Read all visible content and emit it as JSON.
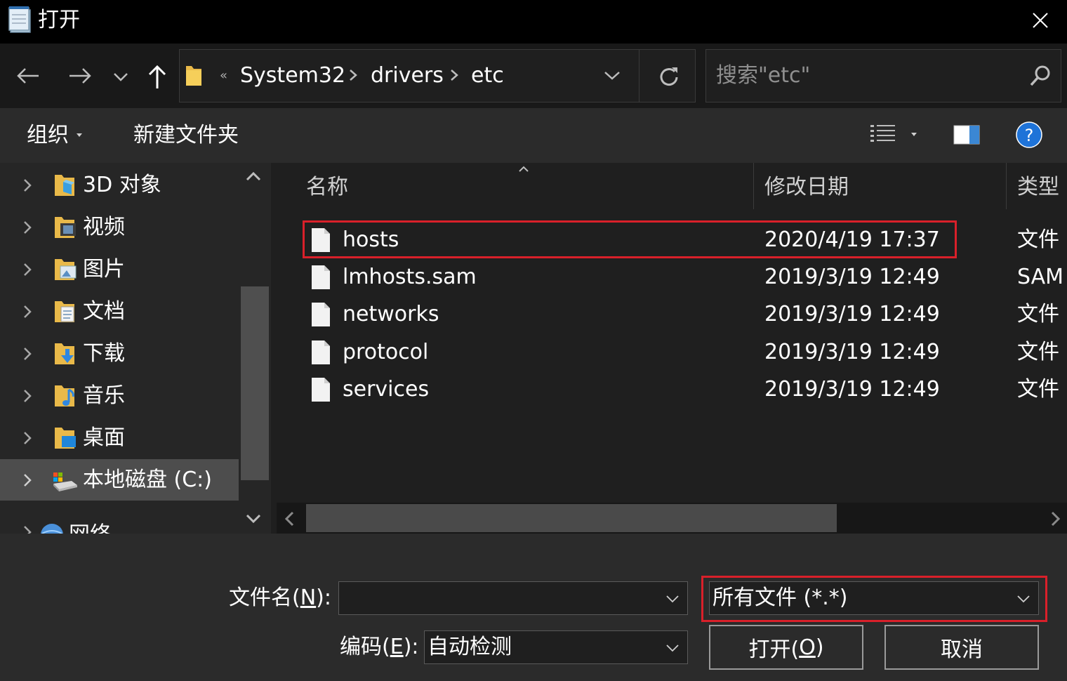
{
  "window": {
    "title": "打开"
  },
  "nav": {
    "breadcrumb_overflow": "«",
    "breadcrumbs": [
      "System32",
      "drivers",
      "etc"
    ],
    "search_placeholder": "搜索\"etc\""
  },
  "toolbar": {
    "organize_label": "组织",
    "new_folder_label": "新建文件夹"
  },
  "sidebar": {
    "items": [
      {
        "label": "3D 对象",
        "icon": "3d-objects-folder-icon"
      },
      {
        "label": "视频",
        "icon": "videos-folder-icon"
      },
      {
        "label": "图片",
        "icon": "pictures-folder-icon"
      },
      {
        "label": "文档",
        "icon": "documents-folder-icon"
      },
      {
        "label": "下载",
        "icon": "downloads-folder-icon"
      },
      {
        "label": "音乐",
        "icon": "music-folder-icon"
      },
      {
        "label": "桌面",
        "icon": "desktop-folder-icon"
      },
      {
        "label": "本地磁盘 (C:)",
        "icon": "local-disk-icon",
        "selected": true
      },
      {
        "label": "网络",
        "icon": "network-icon"
      }
    ]
  },
  "filelist": {
    "columns": [
      "名称",
      "修改日期",
      "类型"
    ],
    "rows": [
      {
        "name": "hosts",
        "date": "2020/4/19 17:37",
        "type": "文件",
        "highlighted": true
      },
      {
        "name": "lmhosts.sam",
        "date": "2019/3/19 12:49",
        "type": "SAM"
      },
      {
        "name": "networks",
        "date": "2019/3/19 12:49",
        "type": "文件"
      },
      {
        "name": "protocol",
        "date": "2019/3/19 12:49",
        "type": "文件"
      },
      {
        "name": "services",
        "date": "2019/3/19 12:49",
        "type": "文件"
      }
    ]
  },
  "bottom": {
    "filename_label": "文件名(",
    "filename_key": "N",
    "filename_label_end": "):",
    "filename_value": "",
    "encoding_label": "编码(",
    "encoding_key": "E",
    "encoding_label_end": "):",
    "encoding_value": "自动检测",
    "filter_value": "所有文件  (*.*)",
    "open_label": "打开(",
    "open_key": "O",
    "open_label_end": ")",
    "cancel_label": "取消"
  },
  "colors": {
    "highlight": "#d9202a",
    "help": "#1e73d8"
  }
}
